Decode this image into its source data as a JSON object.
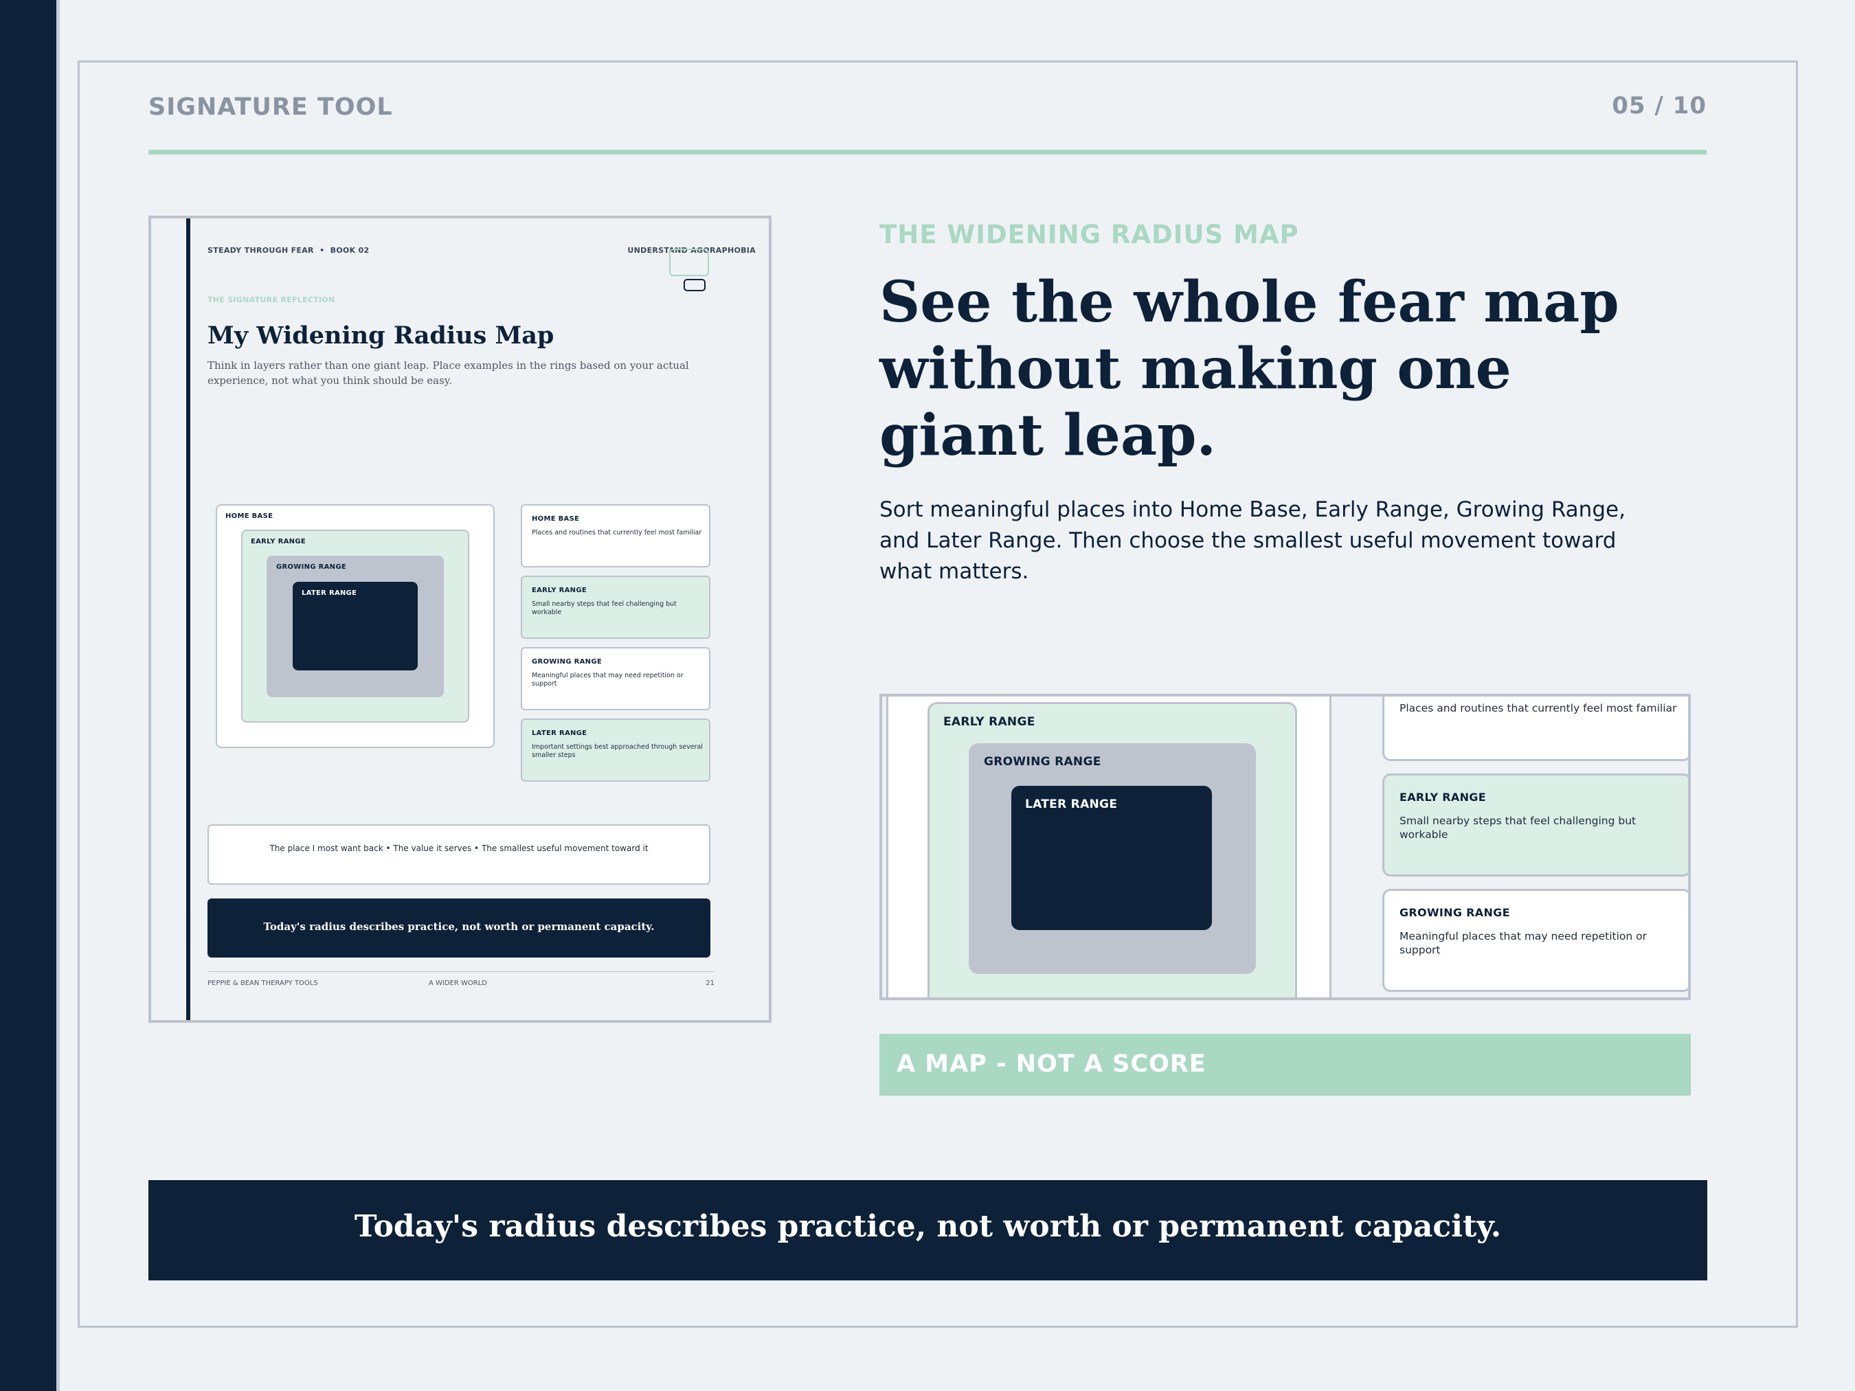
{
  "slide": {
    "header_label": "SIGNATURE TOOL",
    "page_counter": "05 / 10",
    "eyebrow": "THE WIDENING RADIUS MAP",
    "headline": "See the whole fear map without making one giant leap.",
    "body": "Sort meaningful places into Home Base, Early Range, Growing Range, and Later Range. Then choose the smallest useful movement toward what matters.",
    "tag": "A MAP - NOT A SCORE",
    "footer_banner": "Today's radius describes practice, not worth or permanent capacity."
  },
  "worksheet": {
    "header_left": "STEADY THROUGH FEAR  •  BOOK 02",
    "header_right": "UNDERSTAND AGORAPHOBIA",
    "kicker": "THE SIGNATURE REFLECTION",
    "title": "My Widening Radius Map",
    "intro": "Think in layers rather than one giant leap. Place examples in the rings based on your actual experience, not what you think should be easy.",
    "rings": {
      "home": "HOME BASE",
      "early": "EARLY RANGE",
      "growing": "GROWING RANGE",
      "later": "LATER RANGE"
    },
    "legend": [
      {
        "title": "HOME BASE",
        "desc": "Places and routines that currently feel most familiar"
      },
      {
        "title": "EARLY RANGE",
        "desc": "Small nearby steps that feel challenging but workable"
      },
      {
        "title": "GROWING RANGE",
        "desc": "Meaningful places that may need repetition or support"
      },
      {
        "title": "LATER RANGE",
        "desc": "Important settings best approached through several smaller steps"
      }
    ],
    "prompt": "The place I most want back • The value it serves • The smallest useful movement toward it",
    "banner": "Today's radius describes practice, not worth or permanent capacity.",
    "footer_left": "PEPPIE & BEAN THERAPY TOOLS",
    "footer_center": "A WIDER WORLD",
    "footer_right": "21"
  },
  "colors": {
    "navy": "#0d2139",
    "mint": "#a9d8c3",
    "mint_light": "#dcefe6",
    "grey": "#bec4ce",
    "background": "#eef2f5"
  }
}
